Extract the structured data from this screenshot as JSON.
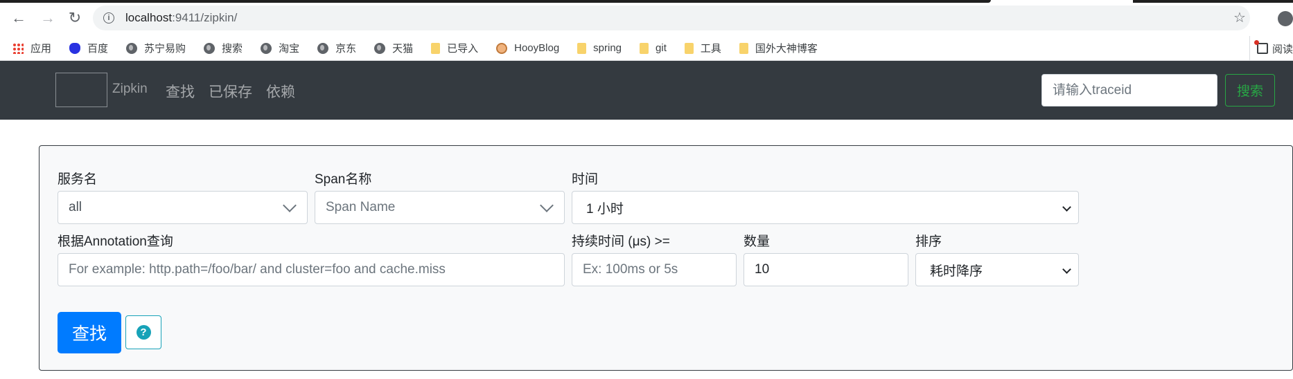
{
  "browser": {
    "url_host": "localhost",
    "url_path": ":9411/zipkin/",
    "bookmarks": [
      "应用",
      "百度",
      "苏宁易购",
      "搜索",
      "淘宝",
      "京东",
      "天猫",
      "已导入",
      "HooyBlog",
      "spring",
      "git",
      "工具",
      "国外大神博客"
    ],
    "reader_label": "阅读"
  },
  "navbar": {
    "brand": "Zipkin",
    "links": [
      "查找",
      "已保存",
      "依赖"
    ],
    "traceid_placeholder": "请输入traceid",
    "search_label": "搜索"
  },
  "query": {
    "service_label": "服务名",
    "service_value": "all",
    "span_label": "Span名称",
    "span_placeholder": "Span Name",
    "time_label": "时间",
    "time_value": "1 小时",
    "annotation_label": "根据Annotation查询",
    "annotation_placeholder": "For example: http.path=/foo/bar/ and cluster=foo and cache.miss",
    "duration_label": "持续时间 (μs) >=",
    "duration_placeholder": "Ex: 100ms or 5s",
    "limit_label": "数量",
    "limit_value": "10",
    "sort_label": "排序",
    "sort_value": "耗时降序",
    "find_label": "查找",
    "help_icon": "?"
  },
  "colors": {
    "navbar_bg": "#343a40",
    "primary": "#007bff",
    "success": "#28a745",
    "info": "#17a2b8"
  }
}
